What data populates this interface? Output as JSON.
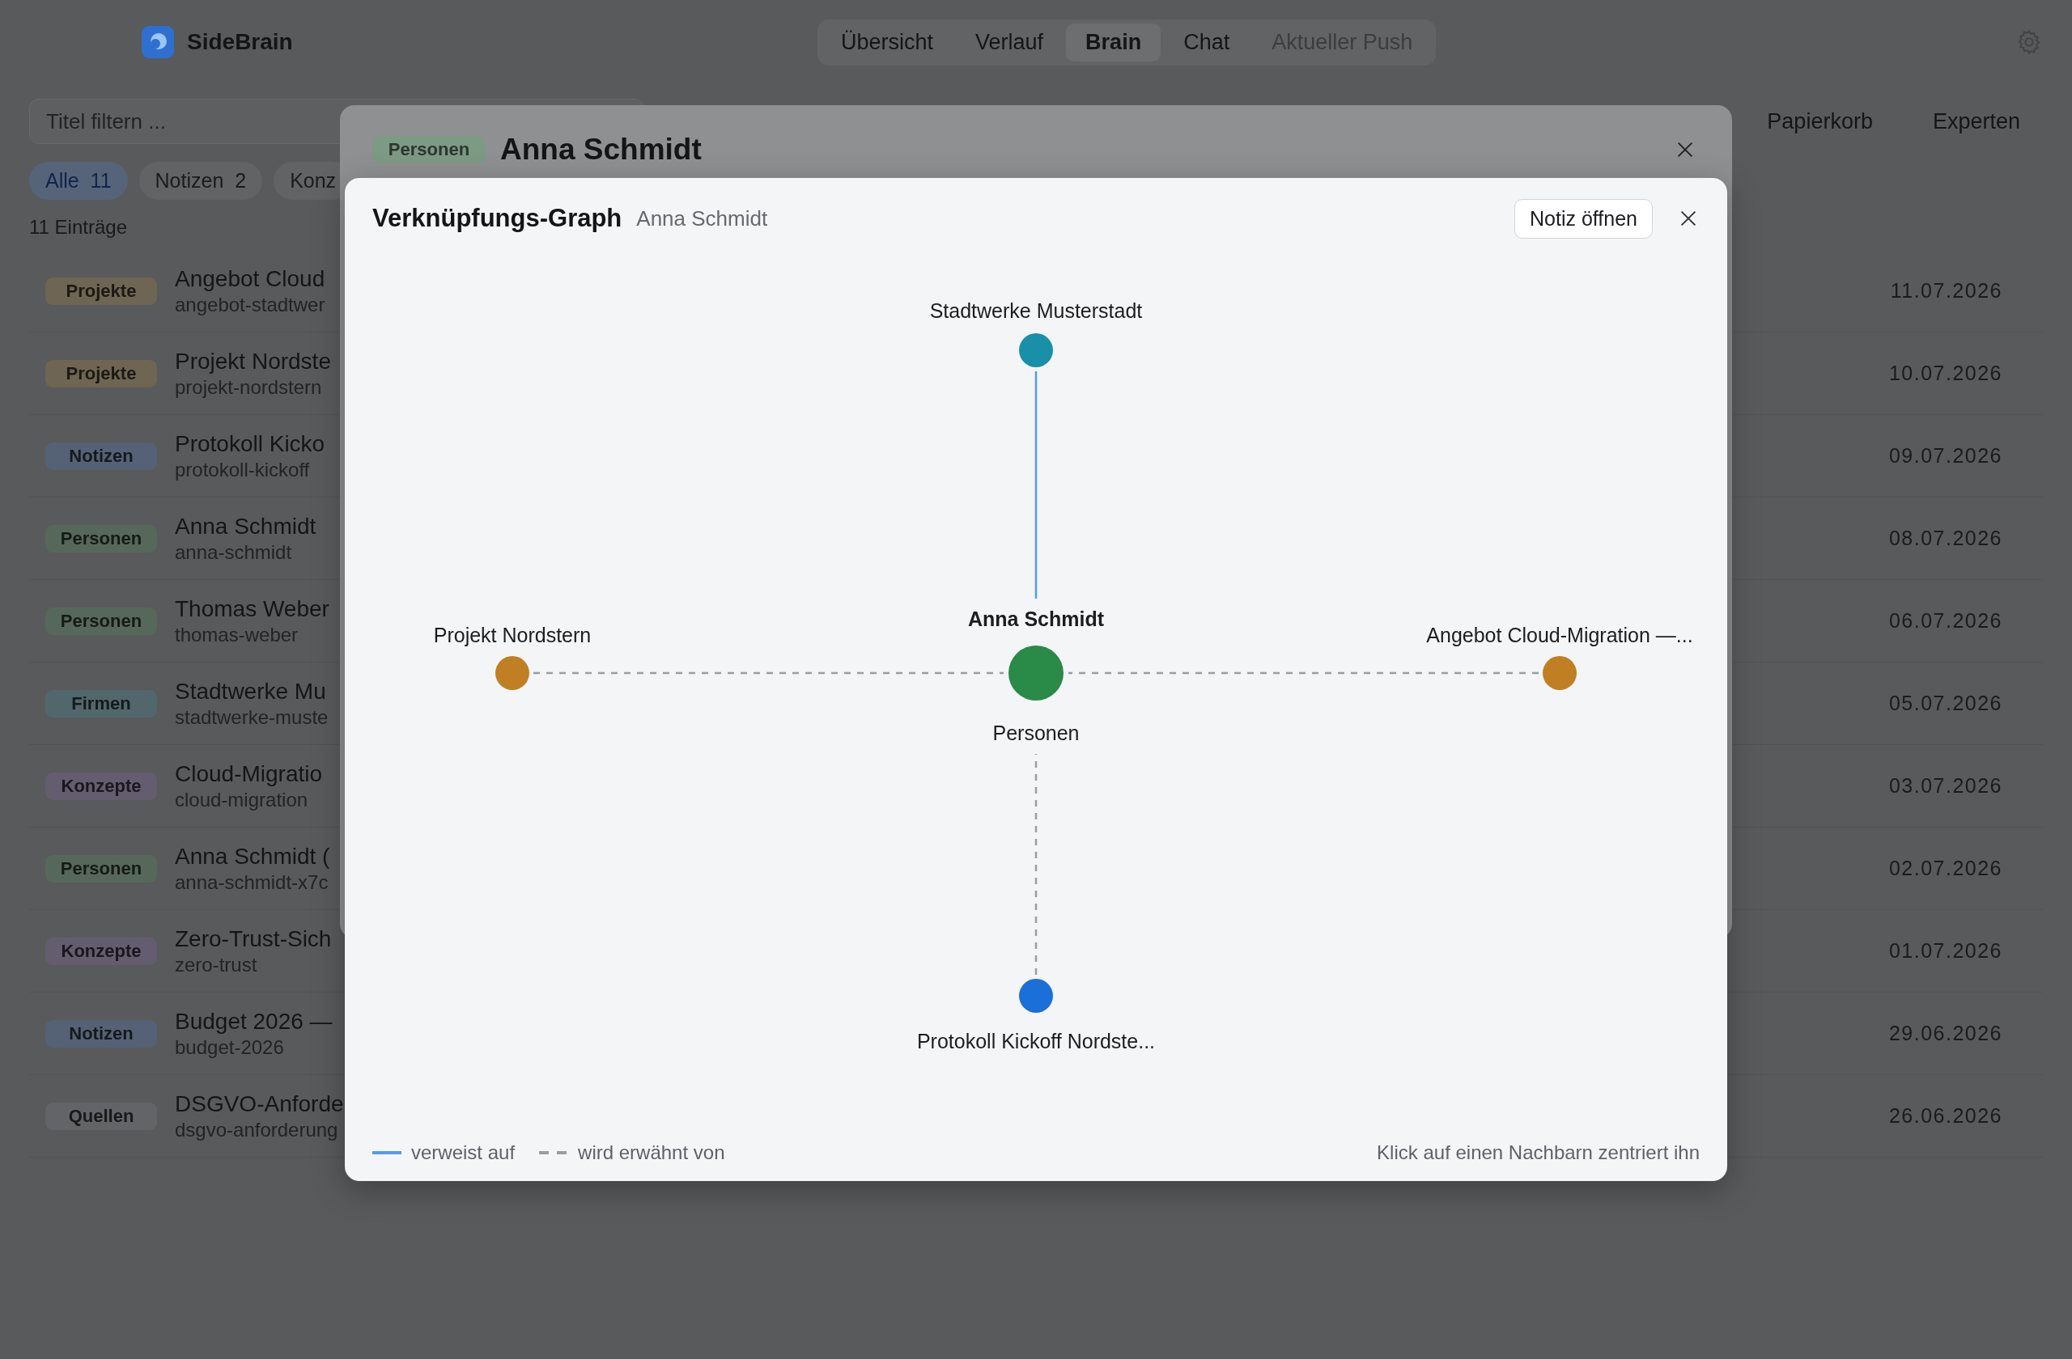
{
  "app": {
    "name": "SideBrain"
  },
  "nav_tabs": [
    {
      "label": "Übersicht",
      "selected": false,
      "disabled": false
    },
    {
      "label": "Verlauf",
      "selected": false,
      "disabled": false
    },
    {
      "label": "Brain",
      "selected": true,
      "disabled": false
    },
    {
      "label": "Chat",
      "selected": false,
      "disabled": false
    },
    {
      "label": "Aktueller Push",
      "selected": false,
      "disabled": true
    }
  ],
  "filter": {
    "placeholder": "Titel filtern ..."
  },
  "toolbar_links": [
    "Papierkorb",
    "Experten"
  ],
  "chips": [
    {
      "label": "Alle",
      "count": "11",
      "selected": true
    },
    {
      "label": "Notizen",
      "count": "2",
      "selected": false
    },
    {
      "label": "Konz",
      "selected": false
    }
  ],
  "entry_count": "11 Einträge",
  "entries": [
    {
      "category": "Projekte",
      "color": "#6e6553",
      "title": "Angebot Cloud",
      "slug": "angebot-stadtwer",
      "date": "11.07.2026"
    },
    {
      "category": "Projekte",
      "color": "#6e6553",
      "title": "Projekt Nordste",
      "slug": "projekt-nordstern",
      "date": "10.07.2026"
    },
    {
      "category": "Notizen",
      "color": "#556275",
      "title": "Protokoll Kicko",
      "slug": "protokoll-kickoff",
      "date": "09.07.2026"
    },
    {
      "category": "Personen",
      "color": "#56685a",
      "title": "Anna Schmidt",
      "slug": "anna-schmidt",
      "date": "08.07.2026"
    },
    {
      "category": "Personen",
      "color": "#56685a",
      "title": "Thomas Weber",
      "slug": "thomas-weber",
      "date": "06.07.2026"
    },
    {
      "category": "Firmen",
      "color": "#51676b",
      "title": "Stadtwerke Mu",
      "slug": "stadtwerke-muste",
      "date": "05.07.2026"
    },
    {
      "category": "Konzepte",
      "color": "#645d70",
      "title": "Cloud-Migratio",
      "slug": "cloud-migration",
      "date": "03.07.2026"
    },
    {
      "category": "Personen",
      "color": "#56685a",
      "title": "Anna Schmidt (",
      "slug": "anna-schmidt-x7c",
      "date": "02.07.2026"
    },
    {
      "category": "Konzepte",
      "color": "#645d70",
      "title": "Zero-Trust-Sich",
      "slug": "zero-trust",
      "date": "01.07.2026"
    },
    {
      "category": "Notizen",
      "color": "#556275",
      "title": "Budget 2026 —",
      "slug": "budget-2026",
      "date": "29.06.2026"
    },
    {
      "category": "Quellen",
      "color": "#626468",
      "title": "DSGVO-Anforde",
      "slug": "dsgvo-anforderung",
      "date": "26.06.2026"
    }
  ],
  "note_dialog": {
    "category": "Personen",
    "color": "#7d9a84",
    "title": "Anna Schmidt"
  },
  "graph_dialog": {
    "title": "Verknüpfungs-Graph",
    "subtitle": "Anna Schmidt",
    "open_button": "Notiz öffnen",
    "center": {
      "label": "Anna Schmidt",
      "category": "Personen",
      "color": "#2a8a48"
    },
    "neighbors": [
      {
        "label": "Stadtwerke Musterstadt",
        "color": "#1a8fa8",
        "kind": "outgoing"
      },
      {
        "label": "Angebot Cloud-Migration —...",
        "color": "#c07f22",
        "kind": "incoming"
      },
      {
        "label": "Protokoll Kickoff Nordste...",
        "color": "#1a6fd8",
        "kind": "incoming"
      },
      {
        "label": "Projekt Nordstern",
        "color": "#c07f22",
        "kind": "incoming"
      }
    ],
    "legend": [
      {
        "label": "verweist auf",
        "kind": "outgoing"
      },
      {
        "label": "wird erwähnt von",
        "kind": "incoming"
      }
    ],
    "hint": "Klick auf einen Nachbarn zentriert ihn"
  }
}
